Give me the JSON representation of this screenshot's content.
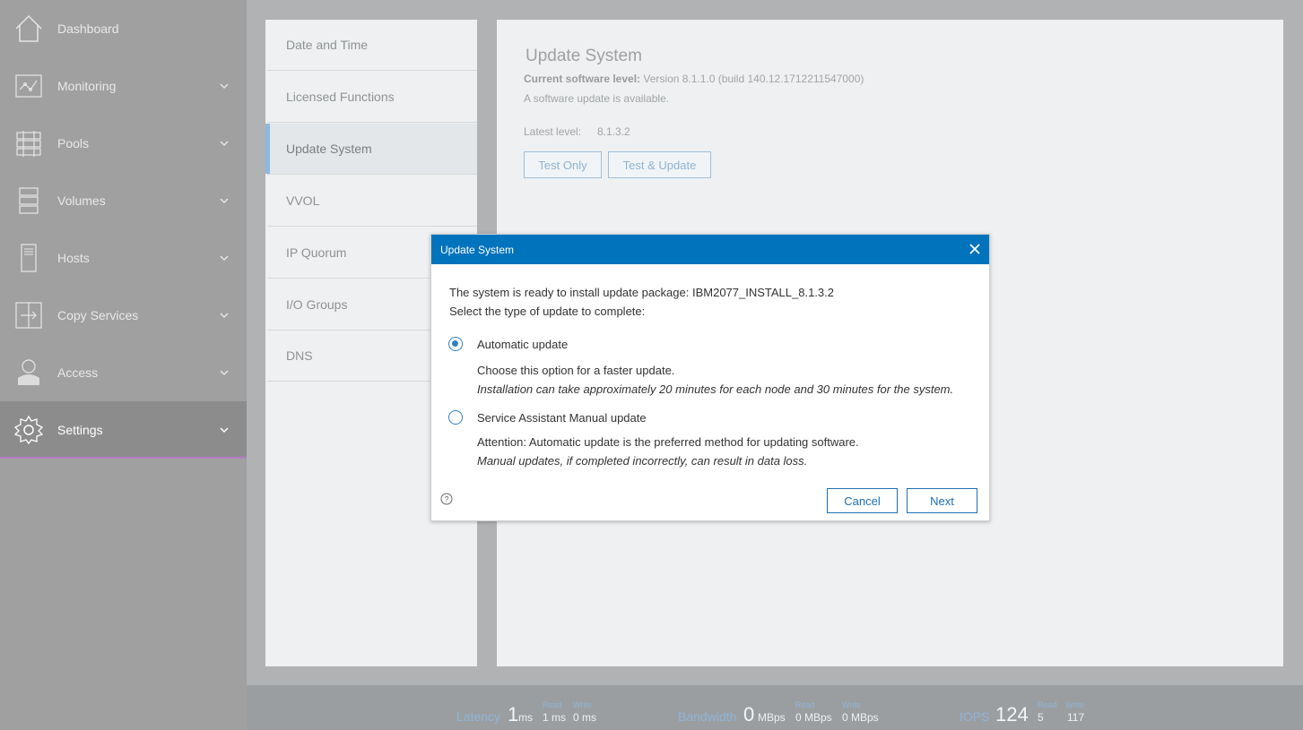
{
  "sidebar": {
    "items": [
      {
        "label": "Dashboard",
        "icon": "home-icon"
      },
      {
        "label": "Monitoring",
        "icon": "monitoring-icon"
      },
      {
        "label": "Pools",
        "icon": "pools-icon"
      },
      {
        "label": "Volumes",
        "icon": "volumes-icon"
      },
      {
        "label": "Hosts",
        "icon": "hosts-icon"
      },
      {
        "label": "Copy Services",
        "icon": "copy-services-icon"
      },
      {
        "label": "Access",
        "icon": "access-icon"
      },
      {
        "label": "Settings",
        "icon": "gear-icon"
      }
    ]
  },
  "subnav": {
    "items": [
      "Date and Time",
      "Licensed Functions",
      "Update System",
      "VVOL",
      "IP Quorum",
      "I/O Groups",
      "DNS"
    ]
  },
  "content": {
    "title": "Update System",
    "current_label": "Current software level:",
    "current_value": "Version 8.1.1.0 (build 140.12.1712211547000)",
    "available": "A software update is available.",
    "latest_label": "Latest level:",
    "latest_value": "8.1.3.2",
    "test_only": "Test Only",
    "test_update": "Test & Update"
  },
  "modal": {
    "title": "Update System",
    "line1": "The system is ready to install update package: IBM2077_INSTALL_8.1.3.2",
    "line2": "Select the type of update to complete:",
    "auto_label": "Automatic update",
    "auto_desc": "Choose this option for a faster update.",
    "auto_note": "Installation can take approximately 20 minutes for each node and 30 minutes for the system.",
    "manual_label": "Service Assistant Manual update",
    "manual_desc": "Attention: Automatic update is the preferred method for updating software.",
    "manual_note": "Manual updates, if completed incorrectly, can result in data loss.",
    "cancel": "Cancel",
    "next": "Next"
  },
  "status": {
    "latency_label": "Latency",
    "latency_value": "1",
    "latency_unit": "ms",
    "latency_read_label": "Read",
    "latency_read": "1 ms",
    "latency_write_label": "Write",
    "latency_write": "0 ms",
    "bandwidth_label": "Bandwidth",
    "bandwidth_value": "0",
    "bandwidth_unit": "MBps",
    "bandwidth_read_label": "Read",
    "bandwidth_read": "0 MBps",
    "bandwidth_write_label": "Write",
    "bandwidth_write": "0 MBps",
    "iops_label": "IOPS",
    "iops_value": "124",
    "iops_read_label": "Read",
    "iops_read": "5",
    "iops_write_label": "Write",
    "iops_write": "117"
  },
  "colors": {
    "accent": "#0073bd",
    "active_underline": "#b37cc7"
  }
}
